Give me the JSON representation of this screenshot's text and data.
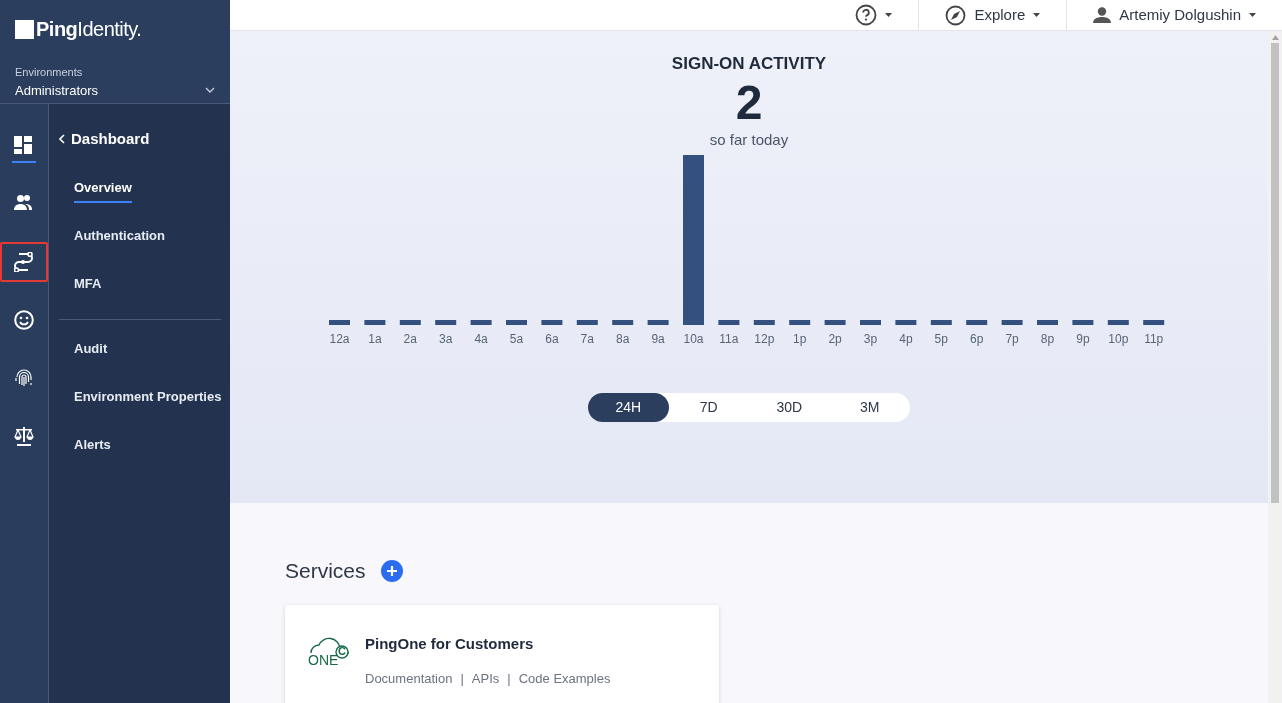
{
  "brand": {
    "logo_text": "**Ping**Identity."
  },
  "environment": {
    "label": "Environments",
    "value": "Administrators"
  },
  "rail_icons": [
    {
      "kind": "dashboard",
      "selected": true,
      "highlighted": false
    },
    {
      "kind": "users",
      "selected": false,
      "highlighted": false
    },
    {
      "kind": "connections",
      "selected": false,
      "highlighted": true
    },
    {
      "kind": "experiences",
      "selected": false,
      "highlighted": false
    },
    {
      "kind": "fingerprint",
      "selected": false,
      "highlighted": false
    },
    {
      "kind": "scales",
      "selected": false,
      "highlighted": false
    }
  ],
  "nav": {
    "back_label": "Dashboard",
    "sections": [
      {
        "items": [
          {
            "label": "Overview",
            "selected": true
          },
          {
            "label": "Authentication",
            "selected": false
          },
          {
            "label": "MFA",
            "selected": false
          }
        ]
      },
      {
        "items": [
          {
            "label": "Audit",
            "selected": false
          },
          {
            "label": "Environment Properties",
            "selected": false
          },
          {
            "label": "Alerts",
            "selected": false
          }
        ]
      }
    ]
  },
  "topbar": {
    "explore": "Explore",
    "user": "Artemiy Dolgushin"
  },
  "activity": {
    "title": "SIGN-ON ACTIVITY",
    "count": "2",
    "subtitle": "so far today",
    "hour_labels": [
      "12a",
      "1a",
      "2a",
      "3a",
      "4a",
      "5a",
      "6a",
      "7a",
      "8a",
      "9a",
      "10a",
      "11a",
      "12p",
      "1p",
      "2p",
      "3p",
      "4p",
      "5p",
      "6p",
      "7p",
      "8p",
      "9p",
      "10p",
      "11p"
    ],
    "ranges": [
      {
        "label": "24H",
        "selected": true
      },
      {
        "label": "7D",
        "selected": false
      },
      {
        "label": "30D",
        "selected": false
      },
      {
        "label": "3M",
        "selected": false
      }
    ]
  },
  "services": {
    "title": "Services",
    "cards": [
      {
        "logo_text": "ONE",
        "logo_badge": "C",
        "name": "PingOne for Customers",
        "links": [
          "Documentation",
          "APIs",
          "Code Examples"
        ],
        "separators": [
          "|",
          "|"
        ]
      }
    ]
  }
}
